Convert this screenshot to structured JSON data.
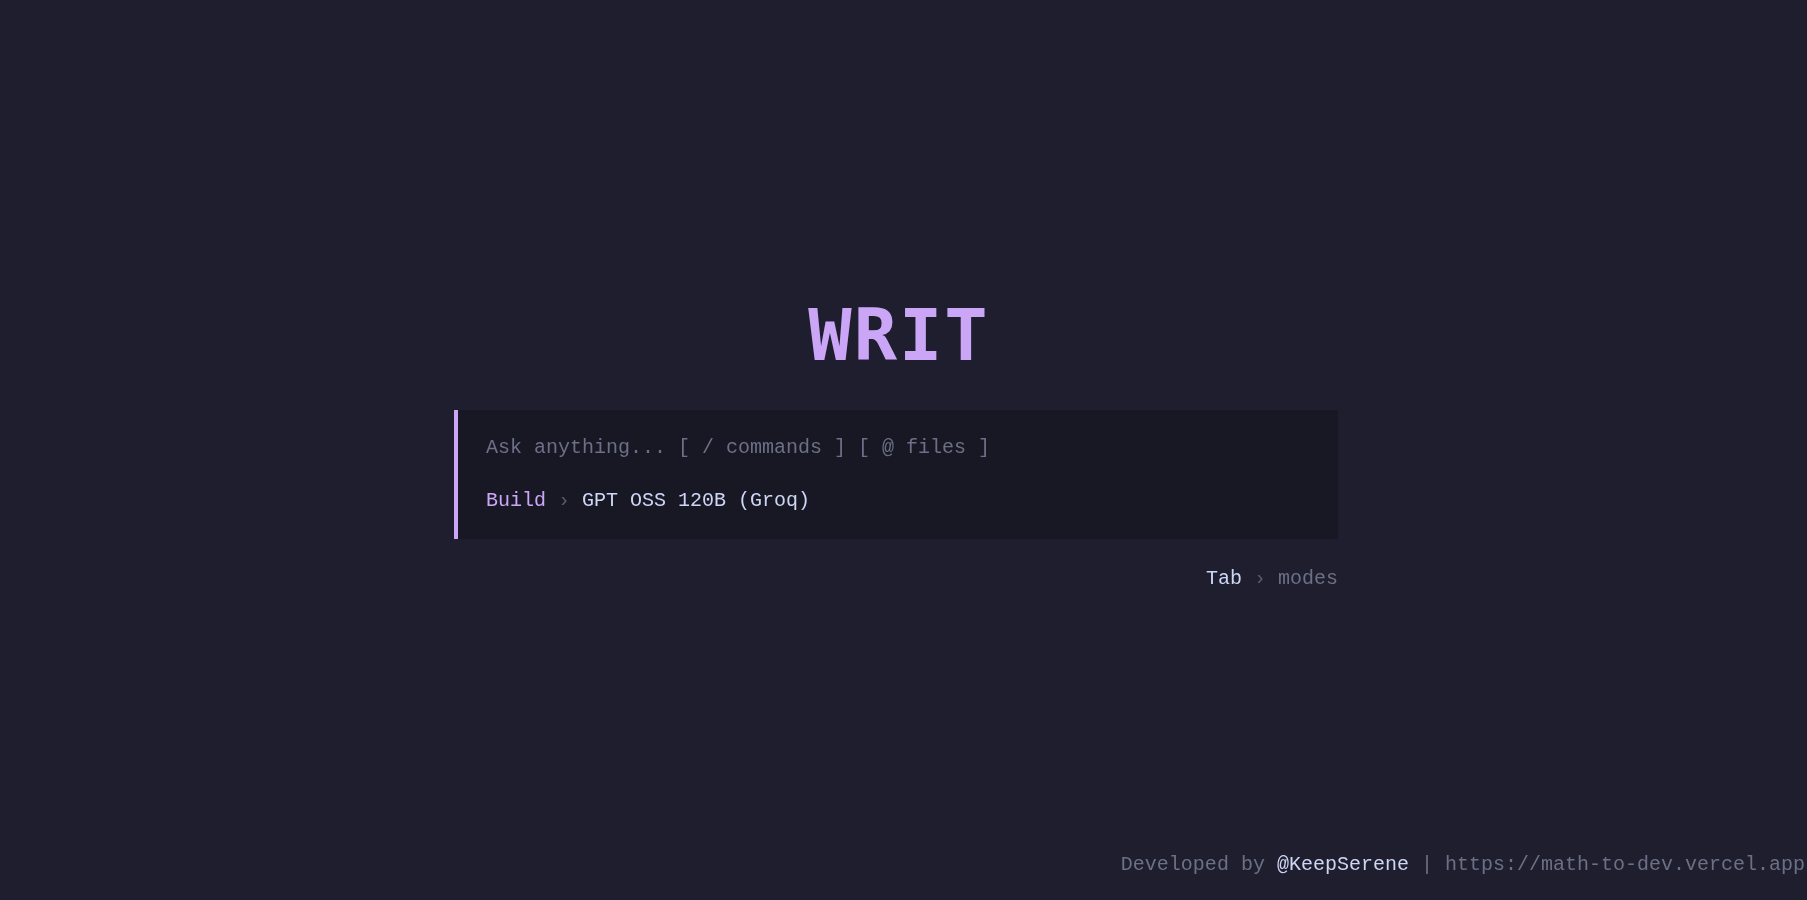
{
  "logo": {
    "text": "WRIT"
  },
  "prompt": {
    "placeholder": "Ask anything... [ / commands ] [ @ files ]",
    "mode": "Build",
    "separator": "›",
    "model": "GPT OSS 120B (Groq)"
  },
  "hint": {
    "key": "Tab",
    "separator": "›",
    "action": "modes"
  },
  "footer": {
    "prefix": "Developed by",
    "author": "@KeepSerene",
    "divider": "|",
    "url": "https://math-to-dev.vercel.app"
  }
}
